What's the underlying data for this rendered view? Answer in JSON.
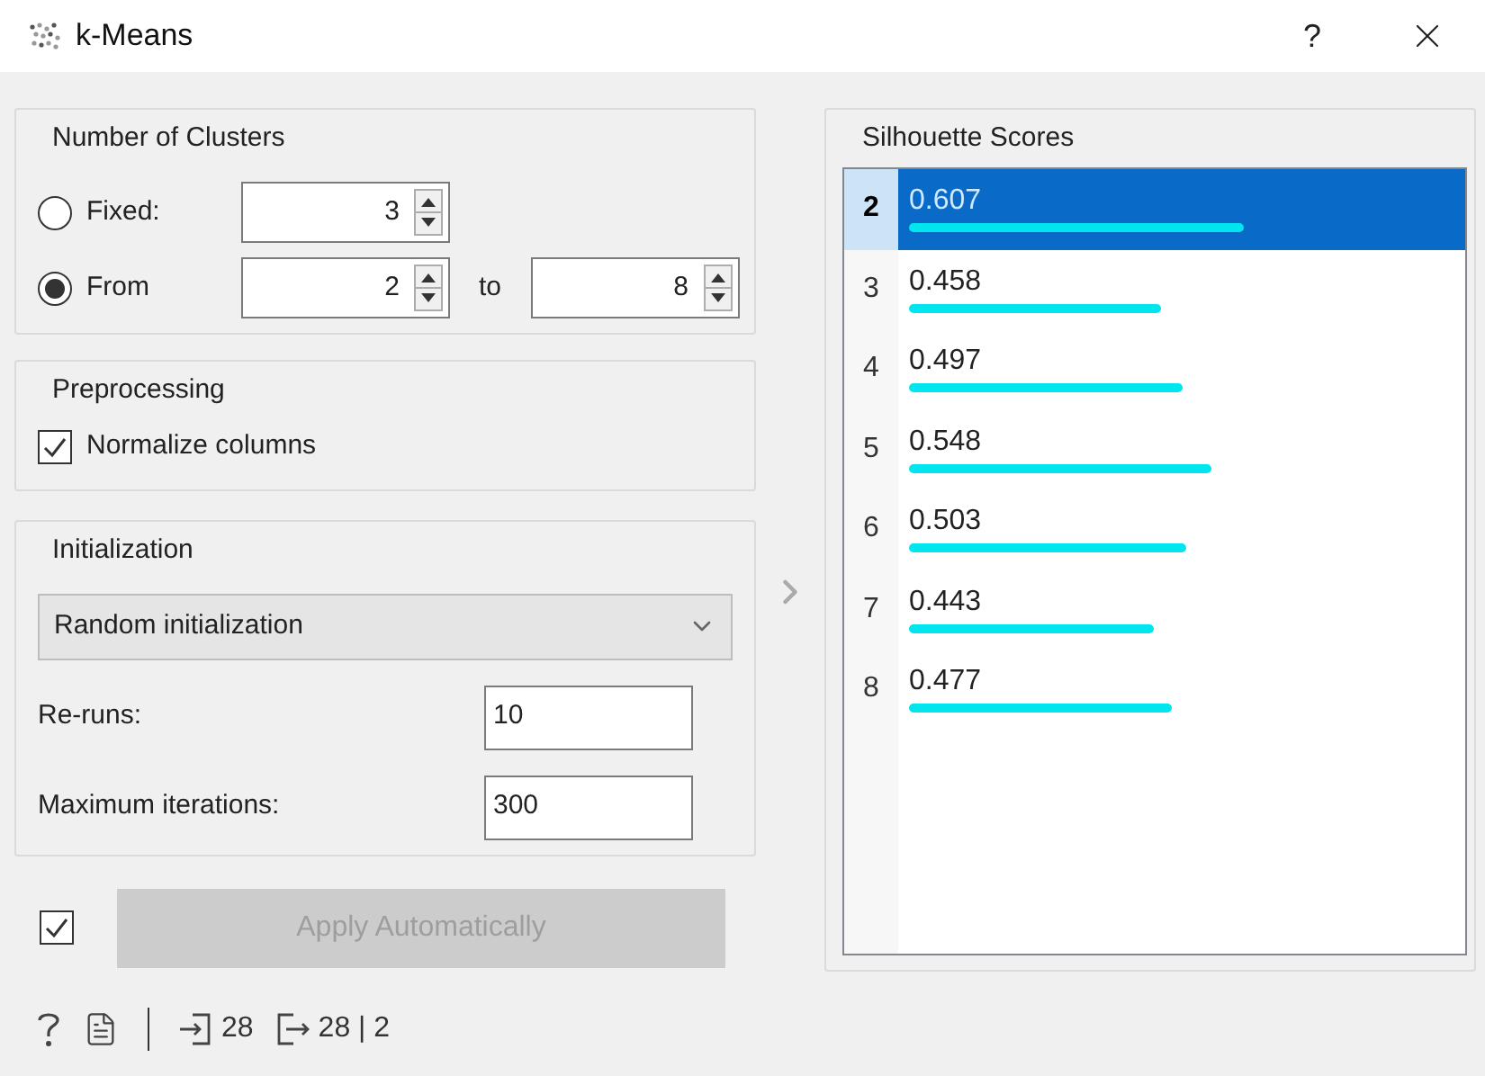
{
  "window": {
    "title": "k-Means",
    "help": "?"
  },
  "clusters": {
    "title": "Number of Clusters",
    "options": [
      {
        "kind": "fixed",
        "label": "Fixed:",
        "selected": false,
        "value": "3"
      },
      {
        "kind": "range",
        "label": "From",
        "selected": true,
        "value": "2",
        "separator": "to",
        "value_to": "8"
      }
    ]
  },
  "preprocessing": {
    "title": "Preprocessing",
    "checkbox": {
      "label": "Normalize columns",
      "checked": true
    }
  },
  "initialization": {
    "title": "Initialization",
    "method": "Random initialization",
    "fields": [
      {
        "label": "Re-runs:",
        "value": "10"
      },
      {
        "label": "Maximum iterations:",
        "value": "300"
      }
    ]
  },
  "apply": {
    "auto_checked": true,
    "label": "Apply Automatically",
    "disabled": true
  },
  "status": {
    "input_count": "28",
    "output_count": "28 | 2"
  },
  "scores": {
    "title": "Silhouette Scores",
    "rows": [
      {
        "k": "2",
        "score": "0.607",
        "level": 0.607,
        "selected": true
      },
      {
        "k": "3",
        "score": "0.458",
        "level": 0.458,
        "selected": false
      },
      {
        "k": "4",
        "score": "0.497",
        "level": 0.497,
        "selected": false
      },
      {
        "k": "5",
        "score": "0.548",
        "level": 0.548,
        "selected": false
      },
      {
        "k": "6",
        "score": "0.503",
        "level": 0.503,
        "selected": false
      },
      {
        "k": "7",
        "score": "0.443",
        "level": 0.443,
        "selected": false
      },
      {
        "k": "8",
        "score": "0.477",
        "level": 0.477,
        "selected": false
      }
    ]
  }
}
